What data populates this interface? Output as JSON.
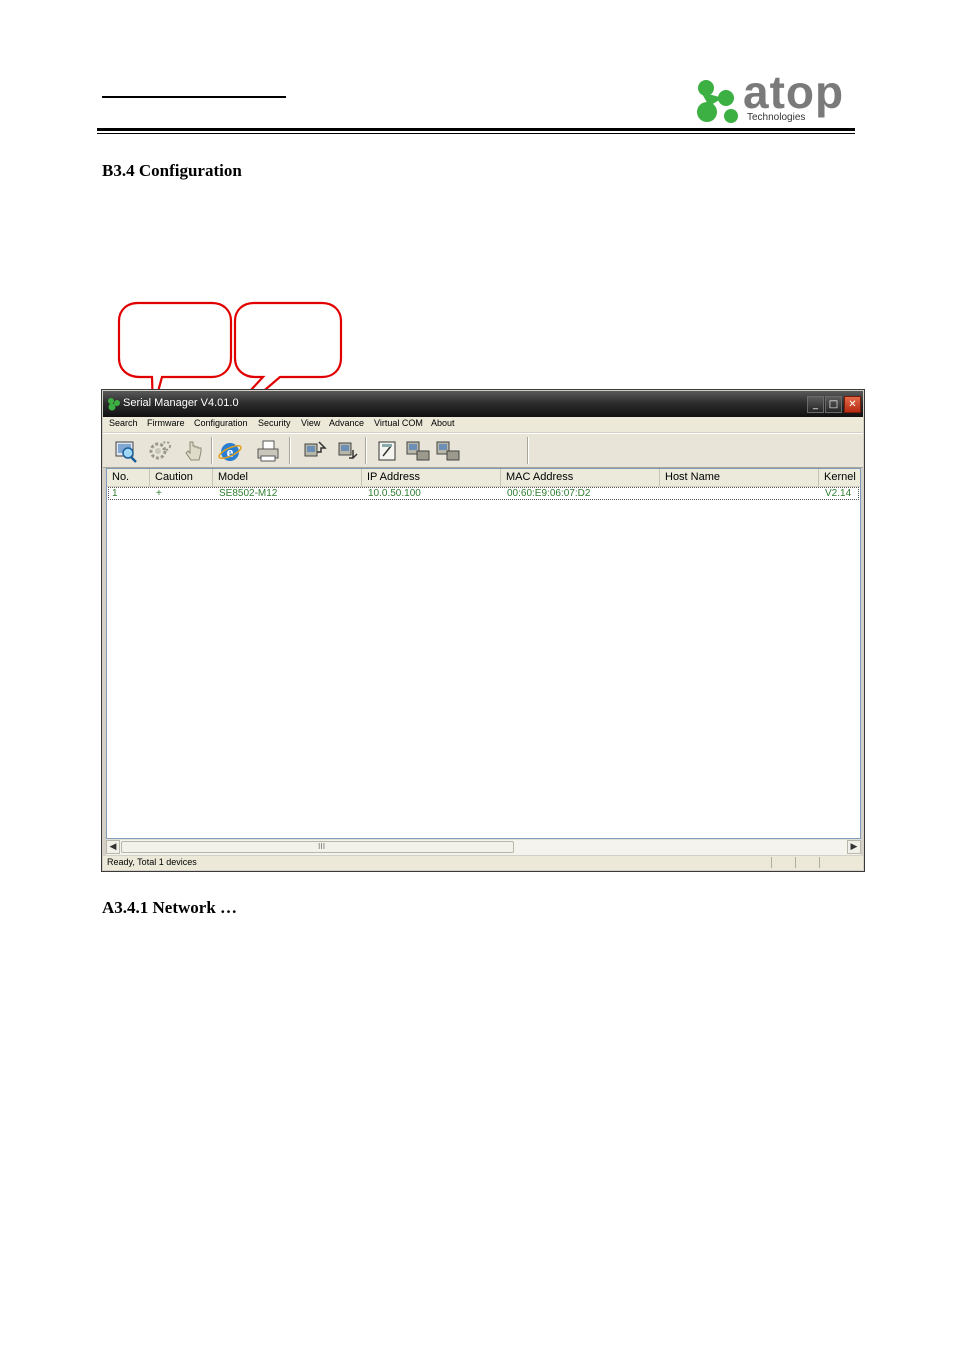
{
  "logo": {
    "brand": "atop",
    "sub": "Technologies"
  },
  "headings": {
    "section": "B3.4 Configuration",
    "subsection": "A3.4.1 Network …"
  },
  "window": {
    "title": "Serial Manager V4.01.0",
    "controls": {
      "minimize": "_",
      "maximize": "□",
      "close": "✕"
    },
    "menu": [
      "Search",
      "Firmware",
      "Configuration",
      "Security",
      "View",
      "Advance",
      "Virtual COM",
      "About"
    ],
    "toolbar_icons": [
      "search-icon",
      "configuration-icon",
      "locate-icon",
      "web-browser-icon",
      "print-icon",
      "firmware-upgrade-icon",
      "firmware-icon",
      "virtual-com-icon",
      "com-add-icon",
      "com-remove-icon"
    ],
    "columns": [
      "No.",
      "Caution",
      "Model",
      "IP Address",
      "MAC Address",
      "Host Name",
      "Kernel"
    ],
    "rows": [
      {
        "no": "1",
        "caution": "+",
        "model": "SE8502-M12",
        "ip": "10.0.50.100",
        "mac": "00:60:E9:06:07:D2",
        "host": "",
        "kernel": "V2.14"
      }
    ],
    "status": "Ready, Total 1 devices",
    "scroll_grip": "III"
  },
  "colors": {
    "row_text": "#2e7d2e",
    "callout": "#e00000",
    "titlebar": "#1e1e1e"
  }
}
